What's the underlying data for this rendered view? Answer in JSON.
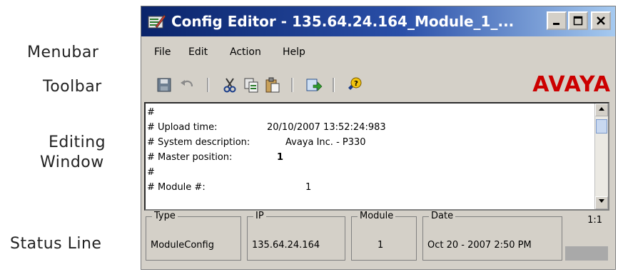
{
  "callouts": {
    "menubar": "Menubar",
    "toolbar": "Toolbar",
    "editing_1": "Editing",
    "editing_2": "Window",
    "status_line": "Status Line"
  },
  "window": {
    "title": "Config Editor - 135.64.24.164_Module_1_...",
    "icon": "config-editor-icon",
    "controls": [
      "minimize",
      "maximize",
      "close"
    ]
  },
  "menubar": {
    "items": [
      "File",
      "Edit",
      "Action",
      "Help"
    ]
  },
  "toolbar": {
    "buttons": [
      "save-icon",
      "undo-icon",
      "cut-icon",
      "copy-icon",
      "paste-icon",
      "upload-icon",
      "help-icon"
    ],
    "logo": "AVAYA",
    "logo_color": "#cc0000"
  },
  "editor": {
    "lines": [
      {
        "key": "#",
        "value": ""
      },
      {
        "key": "# Upload time:",
        "value": "20/10/2007 13:52:24:983"
      },
      {
        "key": "# System description:",
        "value": "Avaya Inc. - P330"
      },
      {
        "key": "# Master position:",
        "value": "1"
      },
      {
        "key": "#",
        "value": ""
      },
      {
        "key": "# Module #:",
        "value": "1"
      }
    ]
  },
  "status": {
    "groups": [
      {
        "label": "Type",
        "value": "ModuleConfig"
      },
      {
        "label": "IP",
        "value": "135.64.24.164"
      },
      {
        "label": "Module",
        "value": "1"
      },
      {
        "label": "Date",
        "value": "Oct 20 - 2007 2:50 PM"
      }
    ],
    "position": "1:1"
  }
}
